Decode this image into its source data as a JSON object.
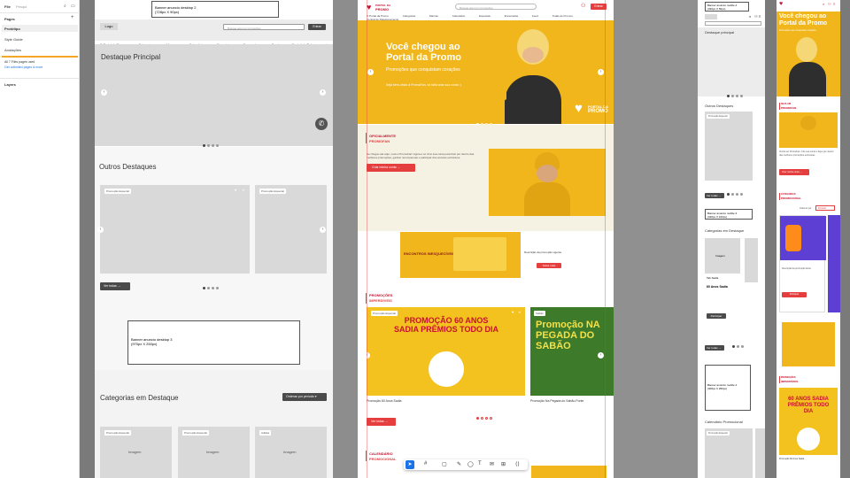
{
  "editor": {
    "file_label": "File",
    "search_placeholder": "Pesqui",
    "pages_heading": "Pages",
    "pages": [
      "Protótipo",
      "Style Guide",
      "Anotações"
    ],
    "info_title": "All 7 Files pages used",
    "info_link": "Get unlimited pages & more",
    "layers_heading": "Layers"
  },
  "wireframe": {
    "banner_top": "Banner anuncio desktop 2\n(728px X 90px)",
    "logo": "Logo",
    "search_placeholder": "Busque aqui por promoções",
    "entrar": "Entrar",
    "nav": [
      "O Portal da Promo",
      "Categorias",
      "Marcas",
      "Calendário",
      "Especiais",
      "Encerradas",
      "Feed",
      "Central de Relacionamento"
    ],
    "destaque_principal": "Destaque Principal",
    "outros_destaques": "Outros Destaques",
    "card_tag_1": "Promoção Especial",
    "card_tag_2": "Promoção Especial",
    "ver_todas": "Ver todas",
    "banner_mid": "Banner anuncio desktop 3\n(970px X 250px)",
    "categorias": "Categorias em Destaque",
    "ordenar": "Ordenar por período",
    "cat_tags": [
      "Promoção Especial",
      "Promoção Especial",
      "Adidas"
    ],
    "imagem": "Imagem"
  },
  "design": {
    "brand_top": "PORTAL DA",
    "brand_bottom": "PROMO",
    "search_placeholder": "Busque aqui por promoções",
    "entrar": "Entrar",
    "nav": [
      "O Portal da Promo",
      "Categorias",
      "Marcas",
      "Calendário",
      "Especiais",
      "Encerradas",
      "Feed",
      "Todas as Promos",
      "Central de Relacionamento"
    ],
    "hero_title": "Você chegou ao\nPortal da Promo",
    "hero_subtitle": "Promoções que conquistam corações",
    "hero_caption": "Seja bem-vindo à PromoFan, só falta criar sua conta :)",
    "hero_logo_top": "PORTAL DA",
    "hero_logo_bottom": "PROMO",
    "section1_kicker": "OFICIALMENTE",
    "section1_title": "PROMOFAN",
    "section1_body": "Se chegou até aqui, você é PromoFan! Agora é só criar sua conta para ficar por dentro das melhores promoções, ganhar recompensas e participar dos sorteios exclusivos.",
    "section1_button": "Criar minha conta",
    "ad_title": "ENCONTROS INESQUECÍVEIS",
    "ad_side_text": "Descrição da promoção vigente",
    "ad_side_button": "Saiba mais",
    "section2_kicker": "PROMOÇÕES",
    "section2_title": "IMPERDÍVEIS",
    "promo1_tag": "Promoção Especial",
    "promo1_art": "PROMOÇÃO 60 ANOS SADIA PRÊMIOS TODO DIA",
    "promo1_caption": "Promoção 60 Anos Sadia",
    "promo2_tag": "Sabão",
    "promo2_art": "Promoção NA PEGADA DO SABÃO",
    "promo2_caption": "Promoção Na Pegada do Sabão Fonte",
    "ver_todas": "Ver todas",
    "section3_kicker": "CALENDÁRIO",
    "section3_title": "PROMOCIONAL"
  },
  "mobile_wire": {
    "banner": "Banner anuncio mobile 2\n(320px X 50px)",
    "destaque": "Destaque principal",
    "outros": "Outros Destaques",
    "tag": "Promoção Especial",
    "ver_todas": "Ver todas",
    "banner2": "Banner anuncio mobile 3\n(320px X 100px)",
    "categorias": "Categorias em Destaque",
    "imagem": "Imagem",
    "item_title": "60 Anos Sadia",
    "item_brand": "Tab Sadia",
    "participar": "Participar",
    "ver_todas2": "Ver todas",
    "banner3": "Banner anuncio mobile 4\n(300px X 250px)",
    "calendario": "Calendário Promocional",
    "tag2": "Promoção Especial"
  },
  "mobile_design": {
    "hero_title": "Você chegou ao\nPortal da Promo",
    "hero_sub": "Promoções que conquistam corações",
    "kicker": "SEJA UM",
    "title": "PROMOFAN",
    "body": "Venha ser PromoFan. Crie sua conta e fique por dentro das melhores promoções exclusivas.",
    "button": "Criar minha conta",
    "cat_kicker": "CATEGORIAS",
    "cat_title": "PROMOCIONAL",
    "ordenar": "Ordenar por",
    "ordenar_value": "Período",
    "card_text": "Descrição da promoção fanta",
    "participar": "Participar",
    "promo_kicker": "PROMOÇÕES",
    "promo_title": "IMPERDÍVEIS",
    "promo_caption": "Promoção 60 Anos Sadia",
    "art": "60 ANOS SADIA PRÊMIOS TODO DIA"
  },
  "colors": {
    "accent": "#e53e3e",
    "yellow": "#f0b61c",
    "brand_red": "#c8102e"
  }
}
